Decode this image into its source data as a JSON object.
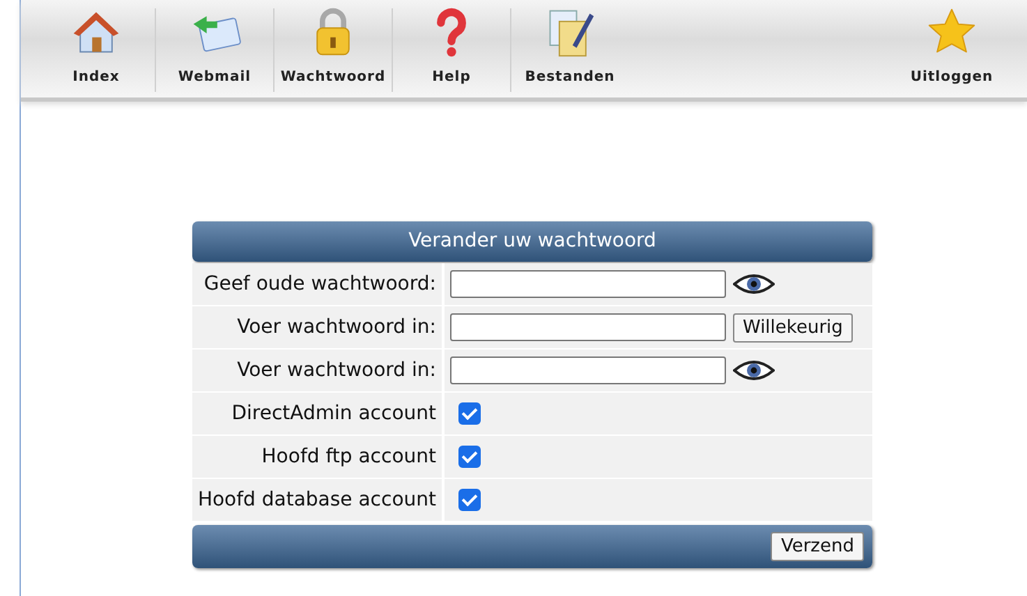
{
  "nav": [
    {
      "label": "Index"
    },
    {
      "label": "Webmail"
    },
    {
      "label": "Wachtwoord"
    },
    {
      "label": "Help"
    },
    {
      "label": "Bestanden"
    }
  ],
  "logout": {
    "label": "Uitloggen"
  },
  "form": {
    "title": "Verander uw wachtwoord",
    "rows": [
      {
        "kind": "password-reveal",
        "label": "Geef oude wachtwoord:"
      },
      {
        "kind": "password-generate",
        "label": "Voer wachtwoord in:",
        "button": "Willekeurig"
      },
      {
        "kind": "password-reveal",
        "label": "Voer wachtwoord in:"
      },
      {
        "kind": "checkbox",
        "label": "DirectAdmin account",
        "checked": true
      },
      {
        "kind": "checkbox",
        "label": "Hoofd ftp account",
        "checked": true
      },
      {
        "kind": "checkbox",
        "label": "Hoofd database account",
        "checked": true
      }
    ],
    "submit": "Verzend"
  }
}
